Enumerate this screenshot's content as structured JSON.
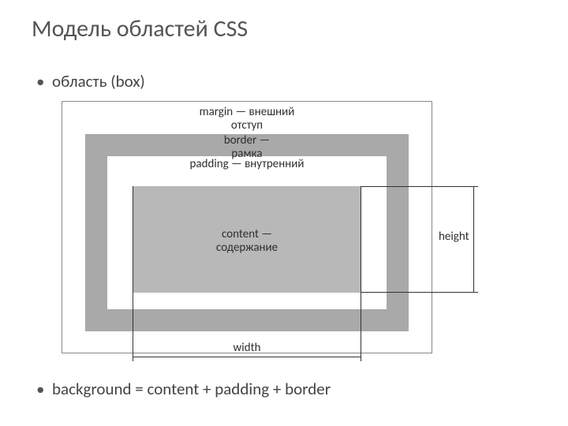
{
  "title": "Модель областей CSS",
  "bullets": {
    "first": "область (box)",
    "second": "background = content + padding + border"
  },
  "diagram": {
    "margin_label_line1": "margin — внешний",
    "margin_label_line2": "отступ",
    "border_label_line1": "border —",
    "border_label_line2": "рамка",
    "padding_label": "padding — внутренний",
    "content_label_line1": "content —",
    "content_label_line2": "содержание",
    "width_label": "width",
    "height_label": "height"
  }
}
